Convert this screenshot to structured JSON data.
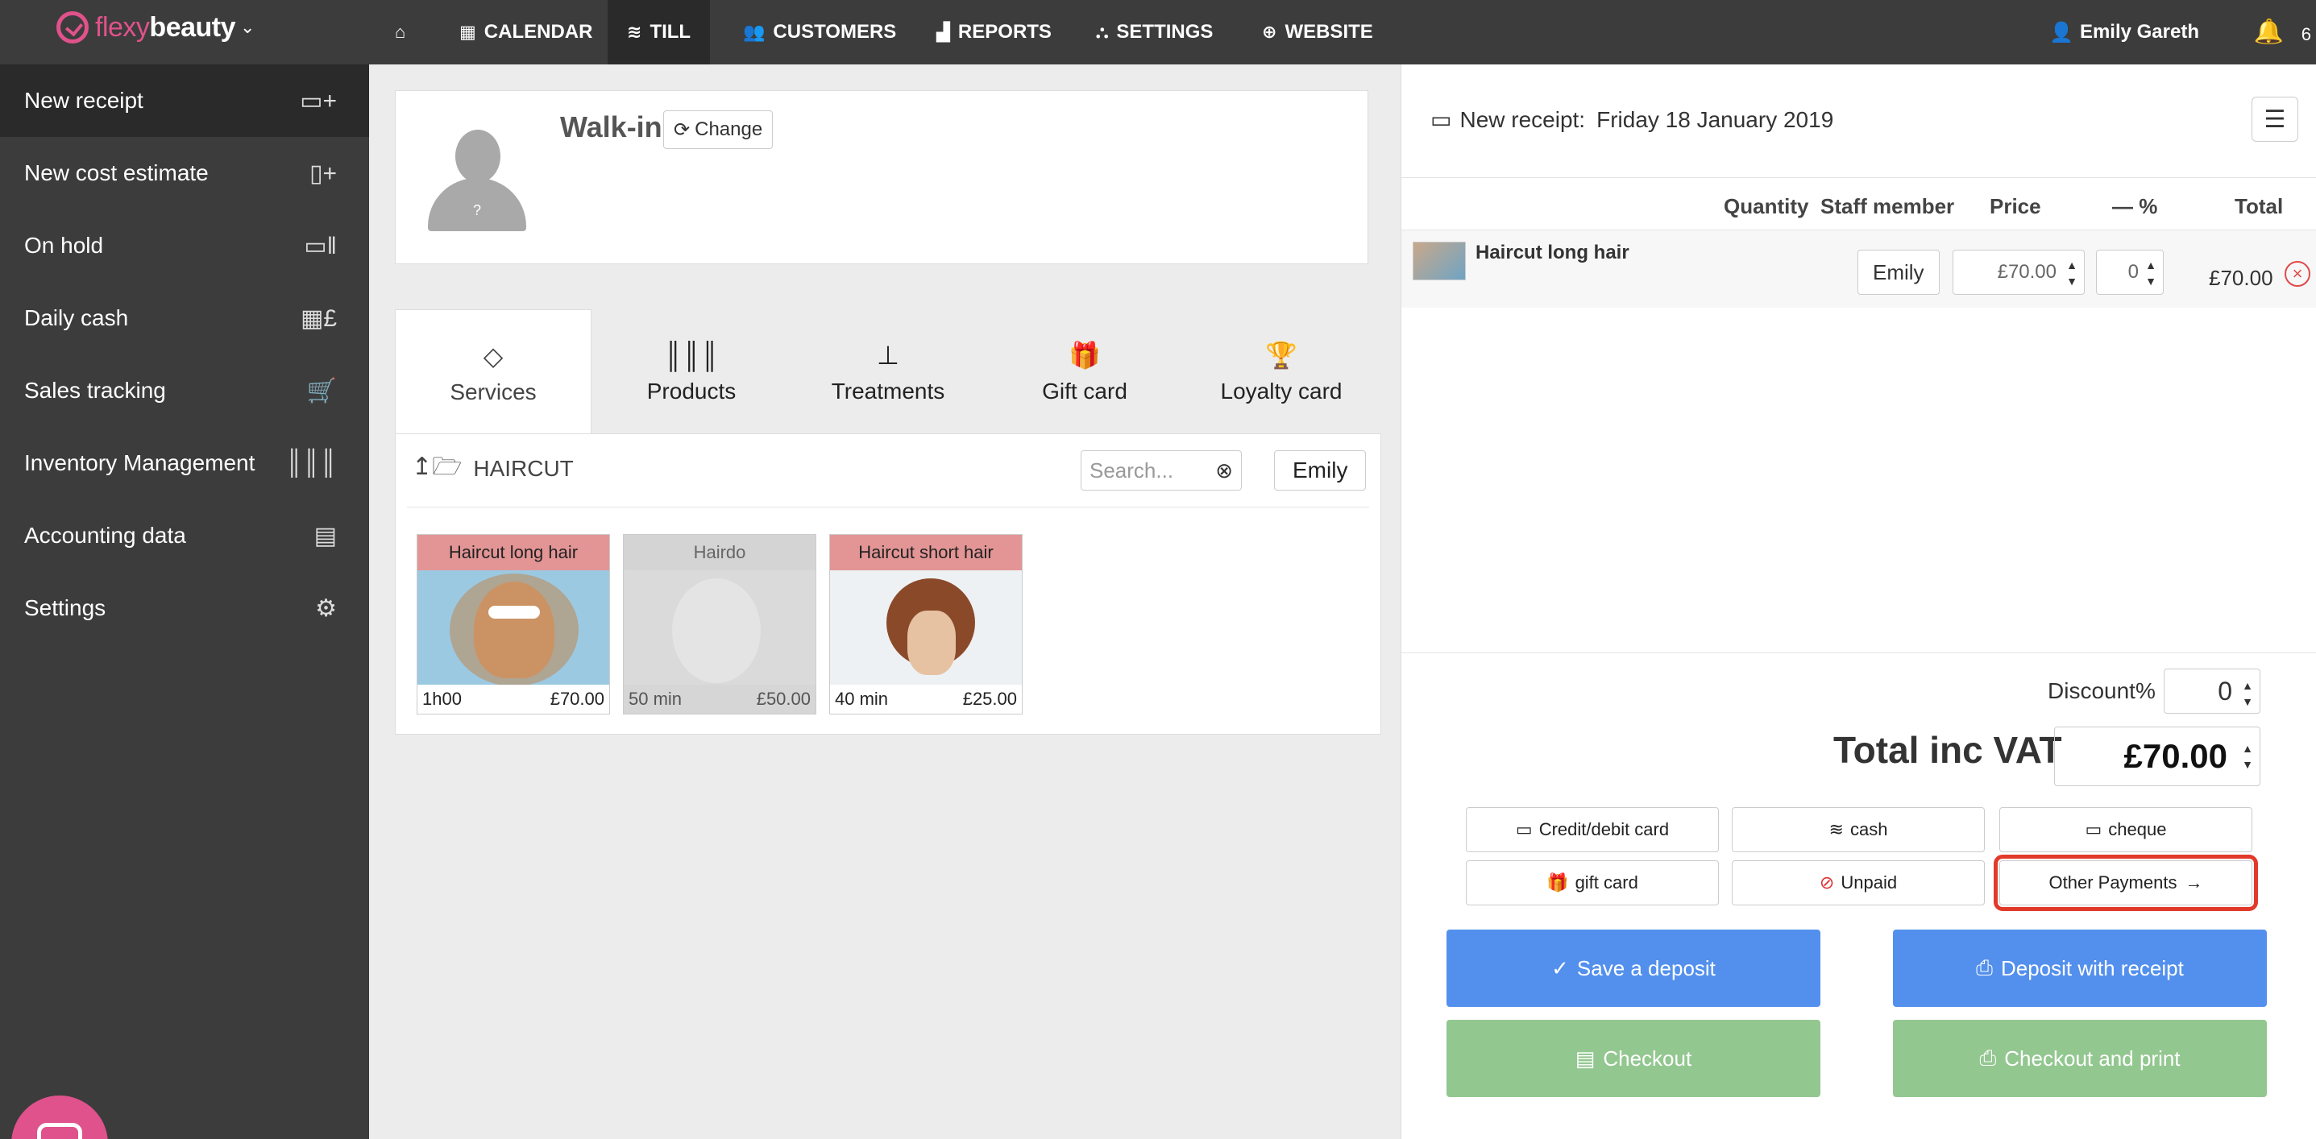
{
  "brand": {
    "flexy": "flexy",
    "beauty": "beauty"
  },
  "topnav": {
    "items": [
      {
        "label": "",
        "icon": "home-icon"
      },
      {
        "label": "CALENDAR",
        "icon": "calendar-icon"
      },
      {
        "label": "TILL",
        "icon": "coins-icon"
      },
      {
        "label": "CUSTOMERS",
        "icon": "users-icon"
      },
      {
        "label": "REPORTS",
        "icon": "chart-icon"
      },
      {
        "label": "SETTINGS",
        "icon": "store-icon"
      },
      {
        "label": "WEBSITE",
        "icon": "globe-icon"
      }
    ],
    "user": "Emily Gareth",
    "notif_count": "6"
  },
  "sidebar": {
    "items": [
      {
        "label": "New receipt"
      },
      {
        "label": "New cost estimate"
      },
      {
        "label": "On hold"
      },
      {
        "label": "Daily cash"
      },
      {
        "label": "Sales tracking"
      },
      {
        "label": "Inventory Management"
      },
      {
        "label": "Accounting data"
      },
      {
        "label": "Settings"
      }
    ]
  },
  "customer": {
    "name": "Walk-in",
    "change_label": "Change",
    "avatar_mark": "?"
  },
  "tabs": [
    {
      "label": "Services"
    },
    {
      "label": "Products"
    },
    {
      "label": "Treatments"
    },
    {
      "label": "Gift card"
    },
    {
      "label": "Loyalty card"
    }
  ],
  "services": {
    "folder": "HAIRCUT",
    "search_placeholder": "Search...",
    "staff": "Emily",
    "items": [
      {
        "name": "Haircut long hair",
        "duration": "1h00",
        "price": "£70.00"
      },
      {
        "name": "Hairdo",
        "duration": "50 min",
        "price": "£50.00"
      },
      {
        "name": "Haircut short hair",
        "duration": "40 min",
        "price": "£25.00"
      }
    ]
  },
  "receipt": {
    "title": "New receipt:",
    "date": "Friday 18 January 2019",
    "columns": {
      "quantity": "Quantity",
      "staff": "Staff member",
      "price": "Price",
      "percent": "— %",
      "total": "Total"
    },
    "line": {
      "name": "Haircut long hair",
      "staff": "Emily",
      "price": "£70.00",
      "percent": "0",
      "total": "£70.00"
    },
    "discount_label": "Discount%",
    "discount_value": "0",
    "total_label": "Total inc VAT",
    "total_value": "£70.00",
    "payments": {
      "card": "Credit/debit card",
      "cash": "cash",
      "cheque": "cheque",
      "gift": "gift card",
      "unpaid": "Unpaid",
      "other": "Other Payments"
    },
    "actions": {
      "save_deposit": "Save a deposit",
      "deposit_receipt": "Deposit with receipt",
      "checkout": "Checkout",
      "checkout_print": "Checkout and print"
    }
  }
}
